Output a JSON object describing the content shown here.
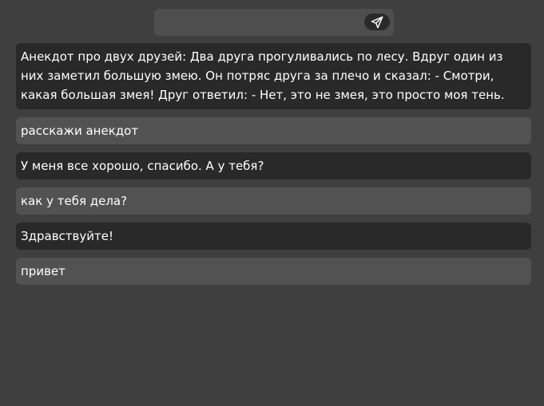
{
  "input": {
    "placeholder": "",
    "value": ""
  },
  "send_icon": "paper-plane-icon",
  "colors": {
    "background": "#3f3f3f",
    "input_bar": "#4e4e4e",
    "bot_bubble": "#292929",
    "user_bubble": "#525252",
    "send_button": "#2a2a2a"
  },
  "messages": [
    {
      "role": "bot",
      "text": "Анекдот про двух друзей: Два друга прогуливались по лесу. Вдруг один из них заметил большую змею. Он потряс друга за плечо и сказал: - Смотри, какая большая змея! Друг ответил: - Нет, это не змея, это просто моя тень."
    },
    {
      "role": "user",
      "text": "расскажи анекдот"
    },
    {
      "role": "bot",
      "text": "У меня все хорошо, спасибо. А у тебя?"
    },
    {
      "role": "user",
      "text": "как у тебя дела?"
    },
    {
      "role": "bot",
      "text": "Здравствуйте!"
    },
    {
      "role": "user",
      "text": "привет"
    }
  ]
}
